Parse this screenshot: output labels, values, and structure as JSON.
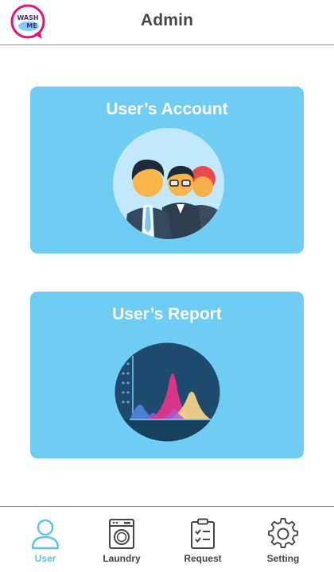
{
  "header": {
    "logo": {
      "line1": "WASH",
      "line2": "ME"
    },
    "title": "Admin"
  },
  "cards": [
    {
      "title": "User’s Account",
      "icon": "users-group-icon"
    },
    {
      "title": "User’s Report",
      "icon": "report-chart-icon"
    }
  ],
  "nav": [
    {
      "label": "User",
      "icon": "user-icon",
      "active": true
    },
    {
      "label": "Laundry",
      "icon": "washing-machine-icon",
      "active": false
    },
    {
      "label": "Request",
      "icon": "clipboard-checklist-icon",
      "active": false
    },
    {
      "label": "Setting",
      "icon": "gear-icon",
      "active": false
    }
  ],
  "colors": {
    "card": "#6fcdf4",
    "active": "#5cc3ef",
    "text": "#4a4446",
    "logo_pink": "#e5127c"
  }
}
